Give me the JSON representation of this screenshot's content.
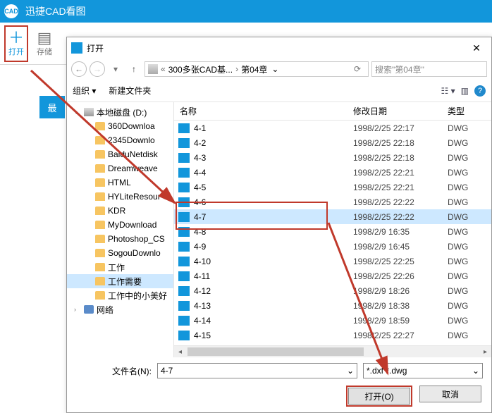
{
  "app": {
    "title": "迅捷CAD看图",
    "logo_text": "CAD",
    "toolbar": {
      "open": "打开",
      "save": "存储"
    },
    "left_tab": "最"
  },
  "dialog": {
    "title": "打开",
    "nav": {
      "crumbs": [
        "300多张CAD基...",
        "第04章"
      ],
      "search_placeholder": "搜索\"第04章\""
    },
    "organize": "组织",
    "new_folder": "新建文件夹",
    "tree": [
      {
        "label": "本地磁盘 (D:)",
        "kind": "drive",
        "expanded": true
      },
      {
        "label": "360Downloa",
        "kind": "folder",
        "sub": true
      },
      {
        "label": "2345Downlo",
        "kind": "folder",
        "sub": true
      },
      {
        "label": "BaiduNetdisk",
        "kind": "folder",
        "sub": true
      },
      {
        "label": "Dreamweave",
        "kind": "folder",
        "sub": true
      },
      {
        "label": "HTML",
        "kind": "folder",
        "sub": true
      },
      {
        "label": "HYLiteResour",
        "kind": "folder",
        "sub": true
      },
      {
        "label": "KDR",
        "kind": "folder",
        "sub": true
      },
      {
        "label": "MyDownload",
        "kind": "folder",
        "sub": true
      },
      {
        "label": "Photoshop_CS",
        "kind": "folder",
        "sub": true
      },
      {
        "label": "SogouDownlo",
        "kind": "folder",
        "sub": true
      },
      {
        "label": "工作",
        "kind": "folder",
        "sub": true
      },
      {
        "label": "工作需要",
        "kind": "folder",
        "sub": true,
        "selected": true
      },
      {
        "label": "工作中的小美好",
        "kind": "folder",
        "sub": true
      },
      {
        "label": "网络",
        "kind": "network",
        "expanded": false
      }
    ],
    "columns": {
      "name": "名称",
      "date": "修改日期",
      "type": "类型"
    },
    "files": [
      {
        "name": "4-1",
        "date": "1998/2/25 22:17",
        "type": "DWG"
      },
      {
        "name": "4-2",
        "date": "1998/2/25 22:18",
        "type": "DWG"
      },
      {
        "name": "4-3",
        "date": "1998/2/25 22:18",
        "type": "DWG"
      },
      {
        "name": "4-4",
        "date": "1998/2/25 22:21",
        "type": "DWG"
      },
      {
        "name": "4-5",
        "date": "1998/2/25 22:21",
        "type": "DWG"
      },
      {
        "name": "4-6",
        "date": "1998/2/25 22:22",
        "type": "DWG"
      },
      {
        "name": "4-7",
        "date": "1998/2/25 22:22",
        "type": "DWG",
        "selected": true
      },
      {
        "name": "4-8",
        "date": "1998/2/9 16:35",
        "type": "DWG"
      },
      {
        "name": "4-9",
        "date": "1998/2/9 16:45",
        "type": "DWG"
      },
      {
        "name": "4-10",
        "date": "1998/2/25 22:25",
        "type": "DWG"
      },
      {
        "name": "4-11",
        "date": "1998/2/25 22:26",
        "type": "DWG"
      },
      {
        "name": "4-12",
        "date": "1998/2/9 18:26",
        "type": "DWG"
      },
      {
        "name": "4-13",
        "date": "1998/2/9 18:38",
        "type": "DWG"
      },
      {
        "name": "4-14",
        "date": "1998/2/9 18:59",
        "type": "DWG"
      },
      {
        "name": "4-15",
        "date": "1998/2/25 22:27",
        "type": "DWG"
      }
    ],
    "filename_label": "文件名(N):",
    "filename_value": "4-7",
    "filter_value": "*.dxf *.dwg",
    "open_btn": "打开(O)",
    "cancel_btn": "取消"
  }
}
